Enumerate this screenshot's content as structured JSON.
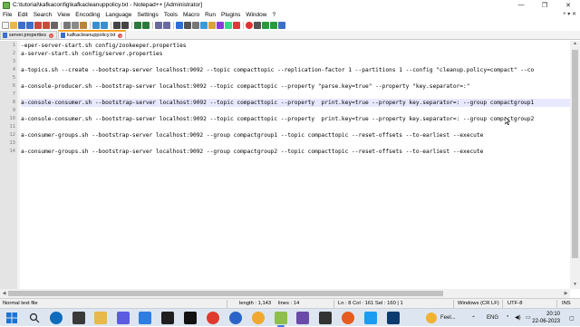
{
  "window": {
    "title": "C:\\tutorial\\kafkaconfig\\kafkacleanuppolicy.txt - Notepad++ [Administrator]",
    "controls": [
      "—",
      "❐",
      "✕"
    ]
  },
  "menu": {
    "items": [
      "File",
      "Edit",
      "Search",
      "View",
      "Encoding",
      "Language",
      "Settings",
      "Tools",
      "Macro",
      "Run",
      "Plugins",
      "Window",
      "?"
    ],
    "right": "+ ▾ ✕"
  },
  "tabs": [
    {
      "label": "server.properties",
      "active": false
    },
    {
      "label": "kafkacleanuppolicy.txt",
      "active": true
    }
  ],
  "editor": {
    "lines": [
      {
        "num": "1",
        "text": "-eper-server-start.sh config/zookeeper.properties"
      },
      {
        "num": "2",
        "text": "a-server-start.sh config/server.properties"
      },
      {
        "num": "3",
        "text": ""
      },
      {
        "num": "4",
        "text": "a-topics.sh --create --bootstrap-server localhost:9092 --topic compacttopic --replication-factor 1 --partitions 1 --config \"cleanup.policy=compact\" --co"
      },
      {
        "num": "5",
        "text": ""
      },
      {
        "num": "6",
        "text": "a-console-producer.sh --bootstrap-server localhost:9092 --topic compacttopic --property \"parse.key=true\" --property \"key.separator=:\""
      },
      {
        "num": "7",
        "text": ""
      },
      {
        "num": "8",
        "text": "a-console-consumer.sh --bootstrap-server localhost:9092 --topic compacttopic --property  print.key=true --property key.separator=: --group compactgroup1"
      },
      {
        "num": "9",
        "text": ""
      },
      {
        "num": "10",
        "text": "a-console-consumer.sh --bootstrap-server localhost:9092 --topic compacttopic --property  print.key=true --property key.separator=: --group compactgroup2"
      },
      {
        "num": "11",
        "text": ""
      },
      {
        "num": "12",
        "text": "a-consumer-groups.sh --bootstrap-server localhost:9092 --group compactgroup1 --topic compacttopic --reset-offsets --to-earliest --execute"
      },
      {
        "num": "13",
        "text": ""
      },
      {
        "num": "14",
        "text": "a-consumer-groups.sh --bootstrap-server localhost:9092 --group compactgroup2 --topic compacttopic --reset-offsets --to-earliest --execute"
      }
    ],
    "current_line": "8"
  },
  "status": {
    "file_type": "Normal text file",
    "length": "length : 1,143",
    "lines": "lines : 14",
    "position": "Ln : 8    Col : 161    Sel : 160 | 1",
    "eol": "Windows (CR LF)",
    "encoding": "UTF-8",
    "mode": "INS"
  },
  "taskbar": {
    "weather": "Feel...",
    "language": "ENG",
    "time": "20:10",
    "date": "22-06-2023"
  },
  "colors": {
    "accent_tab": "#f7a32b",
    "current_line": "#e8e8ff",
    "gutter": "#e4e4e4"
  }
}
